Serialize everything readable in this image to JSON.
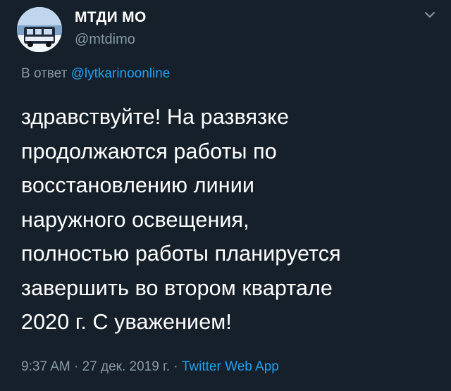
{
  "author": {
    "display_name": "МТДИ МО",
    "handle": "@mtdimo",
    "avatar_icon": "bus-avatar-icon"
  },
  "reply": {
    "prefix": "В ответ",
    "mention": "@lytkarinoonline"
  },
  "tweet": {
    "text": "здравствуйте! На развязке\nпродолжаются работы по\nвосстановлению линии\nнаружного освещения,\nполностью работы планируется\nзавершить во втором квартале\n2020 г. С уважением!"
  },
  "meta": {
    "time": "9:37 AM",
    "separator": "·",
    "date": "27 дек. 2019 г.",
    "source": "Twitter Web App"
  },
  "colors": {
    "background": "#15202b",
    "secondary_text": "#8899a6",
    "accent": "#1da1f2"
  },
  "icons": {
    "menu": "chevron-down-icon"
  }
}
